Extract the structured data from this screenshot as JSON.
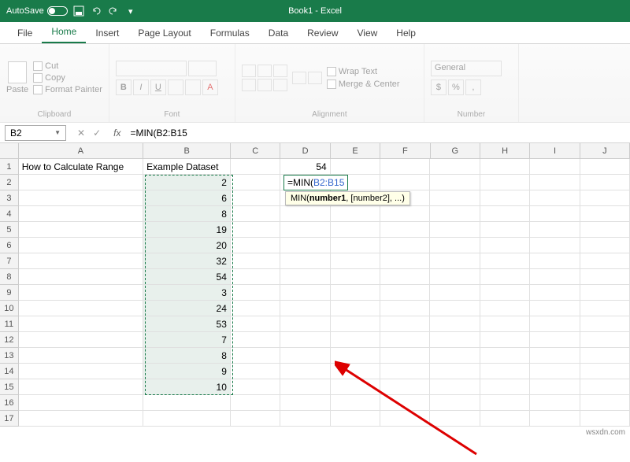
{
  "titlebar": {
    "autosave": "AutoSave",
    "title": "Book1 - Excel"
  },
  "tabs": {
    "file": "File",
    "home": "Home",
    "insert": "Insert",
    "page_layout": "Page Layout",
    "formulas": "Formulas",
    "data": "Data",
    "review": "Review",
    "view": "View",
    "help": "Help"
  },
  "ribbon": {
    "clipboard": {
      "paste": "Paste",
      "cut": "Cut",
      "copy": "Copy",
      "format_painter": "Format Painter",
      "label": "Clipboard"
    },
    "font": {
      "bold": "B",
      "italic": "I",
      "underline": "U",
      "label": "Font"
    },
    "alignment": {
      "wrap": "Wrap Text",
      "merge": "Merge & Center",
      "label": "Alignment"
    },
    "number": {
      "format": "General",
      "label": "Number"
    }
  },
  "formulabar": {
    "namebox": "B2",
    "cancel": "✕",
    "enter": "✓",
    "fx": "fx",
    "formula": "=MIN(B2:B15"
  },
  "columns": [
    "A",
    "B",
    "C",
    "D",
    "E",
    "F",
    "G",
    "H",
    "I",
    "J"
  ],
  "colwidths": {
    "A": 160,
    "B": 112,
    "C": 64,
    "D": 64,
    "E": 64,
    "F": 64,
    "G": 64,
    "H": 64,
    "I": 64,
    "J": 64
  },
  "headers": {
    "A1": "How to Calculate Range",
    "B1": "Example Dataset"
  },
  "dataset": [
    2,
    6,
    8,
    19,
    20,
    32,
    54,
    3,
    24,
    53,
    7,
    8,
    9,
    10
  ],
  "d1": "54",
  "edit": {
    "prefix": "=MIN(",
    "ref": "B2:B15"
  },
  "tooltip": {
    "fn": "MIN(",
    "arg1": "number1",
    "rest": ", [number2], ...)"
  },
  "rows_total": 17,
  "watermark": "wsxdn.com"
}
